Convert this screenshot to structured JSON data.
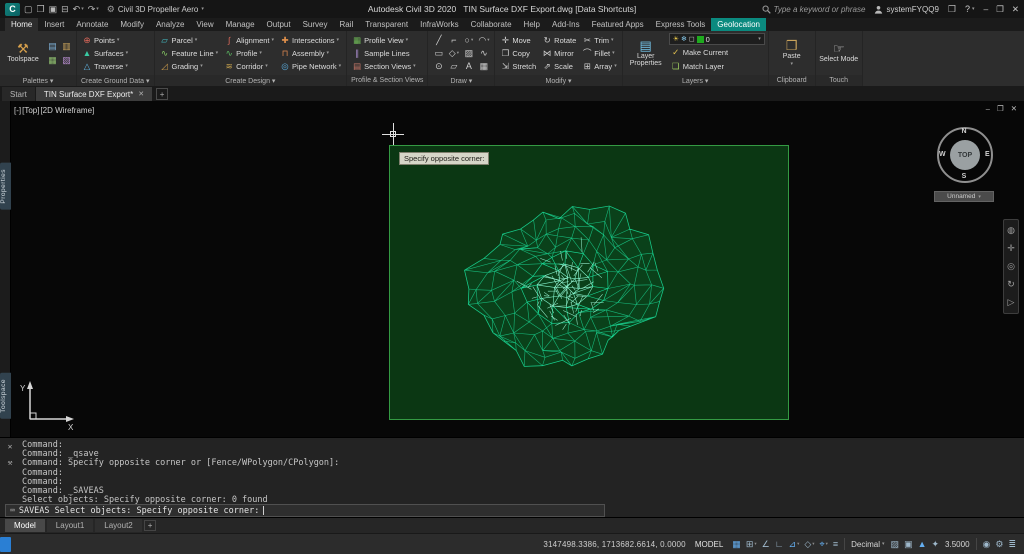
{
  "colors": {
    "accent_teal": "#0b8a7f",
    "mesh_green": "#2bffb4",
    "selection_fill": "#0c4f14",
    "status_blue": "#64aef0",
    "layer_swatch": "#1faa1f"
  },
  "title_bar": {
    "logo": "C",
    "quick_access": [
      {
        "name": "new-file-icon",
        "glyph": "▢"
      },
      {
        "name": "open-file-icon",
        "glyph": "❒"
      },
      {
        "name": "save-icon",
        "glyph": "▣"
      },
      {
        "name": "plot-icon",
        "glyph": "⊟"
      },
      {
        "name": "undo-icon",
        "glyph": "↶",
        "arrow": true
      },
      {
        "name": "redo-icon",
        "glyph": "↷",
        "arrow": true
      }
    ],
    "workspace": "Civil 3D Propeller Aero",
    "title": "Autodesk Civil 3D 2020",
    "document": "TIN Surface DXF Export.dwg",
    "document_badge": "[Data Shortcuts]",
    "search_placeholder": "Type a keyword or phrase",
    "user": "systemFYQQ9",
    "help_label": "?"
  },
  "ribbon": {
    "tabs": [
      {
        "label": "Home",
        "active": true
      },
      {
        "label": "Insert"
      },
      {
        "label": "Annotate"
      },
      {
        "label": "Modify"
      },
      {
        "label": "Analyze"
      },
      {
        "label": "View"
      },
      {
        "label": "Manage"
      },
      {
        "label": "Output"
      },
      {
        "label": "Survey"
      },
      {
        "label": "Rail"
      },
      {
        "label": "Transparent"
      },
      {
        "label": "InfraWorks"
      },
      {
        "label": "Collaborate"
      },
      {
        "label": "Help"
      },
      {
        "label": "Add-Ins"
      },
      {
        "label": "Featured Apps"
      },
      {
        "label": "Express Tools"
      },
      {
        "label": "Geolocation",
        "highlight": true
      }
    ],
    "panels": [
      {
        "label": "Palettes",
        "arrow": true,
        "type": "palettes",
        "big": {
          "label": "Toolspace",
          "icon": "toolbox-icon"
        },
        "small_icons": [
          "tool-palettes-icon",
          "properties-palette-icon",
          "survey-toolspace-icon",
          "panorama-icon"
        ]
      },
      {
        "label": "Create Ground Data",
        "arrow": true,
        "type": "stack",
        "buttons": [
          {
            "label": "Points",
            "icon": "points-icon",
            "arrow": true
          },
          {
            "label": "Surfaces",
            "icon": "surfaces-icon",
            "arrow": true
          },
          {
            "label": "Traverse",
            "icon": "traverse-icon",
            "arrow": true
          }
        ]
      },
      {
        "label": "Create Design",
        "arrow": true,
        "type": "grid3",
        "buttons": [
          {
            "label": "Parcel",
            "icon": "parcel-icon",
            "arrow": true
          },
          {
            "label": "Alignment",
            "icon": "alignment-icon",
            "arrow": true
          },
          {
            "label": "Intersections",
            "icon": "intersections-icon",
            "arrow": true
          },
          {
            "label": "Feature Line",
            "icon": "feature-line-icon",
            "arrow": true
          },
          {
            "label": "Profile",
            "icon": "profile-icon",
            "arrow": true
          },
          {
            "label": "Assembly",
            "icon": "assembly-icon",
            "arrow": true
          },
          {
            "label": "Grading",
            "icon": "grading-icon",
            "arrow": true
          },
          {
            "label": "Corridor",
            "icon": "corridor-icon",
            "arrow": true
          },
          {
            "label": "Pipe Network",
            "icon": "pipe-network-icon",
            "arrow": true
          }
        ]
      },
      {
        "label": "Profile & Section Views",
        "type": "stack",
        "buttons": [
          {
            "label": "Profile View",
            "icon": "profile-view-icon",
            "arrow": true
          },
          {
            "label": "Sample Lines",
            "icon": "sample-lines-icon"
          },
          {
            "label": "Section Views",
            "icon": "section-views-icon",
            "arrow": true
          }
        ]
      },
      {
        "label": "Draw",
        "arrow": true,
        "type": "icons",
        "icons": [
          {
            "name": "line-icon",
            "glyph": "╱"
          },
          {
            "name": "polyline-icon",
            "glyph": "⌐"
          },
          {
            "name": "circle-icon",
            "glyph": "○",
            "arrow": true
          },
          {
            "name": "arc-icon",
            "glyph": "◠",
            "arrow": true
          },
          {
            "name": "rectangle-icon",
            "glyph": "▭"
          },
          {
            "name": "ellipse-icon",
            "glyph": "◇",
            "arrow": true
          },
          {
            "name": "hatch-icon",
            "glyph": "▨"
          },
          {
            "name": "spline-icon",
            "glyph": "∿"
          },
          {
            "name": "point-icon",
            "glyph": "⊙"
          },
          {
            "name": "region-icon",
            "glyph": "▱"
          },
          {
            "name": "multiline-text-icon",
            "glyph": "A"
          },
          {
            "name": "table-icon",
            "glyph": "▦"
          }
        ]
      },
      {
        "label": "Modify",
        "arrow": true,
        "type": "grid3",
        "buttons": [
          {
            "label": "Move",
            "icon": "move-icon"
          },
          {
            "label": "Rotate",
            "icon": "rotate-icon"
          },
          {
            "label": "Trim",
            "icon": "trim-icon",
            "arrow": true
          },
          {
            "label": "Copy",
            "icon": "copy-icon"
          },
          {
            "label": "Mirror",
            "icon": "mirror-icon"
          },
          {
            "label": "Fillet",
            "icon": "fillet-icon",
            "arrow": true
          },
          {
            "label": "Stretch",
            "icon": "stretch-icon"
          },
          {
            "label": "Scale",
            "icon": "scale-icon"
          },
          {
            "label": "Array",
            "icon": "array-icon",
            "arrow": true
          }
        ]
      },
      {
        "label": "Layers",
        "arrow": true,
        "type": "layers",
        "big": {
          "label": "Layer Properties",
          "icon": "layer-properties-icon"
        },
        "combo": {
          "value": "0",
          "icons": [
            "layer-on-icon",
            "layer-freeze-icon",
            "layer-lock-icon"
          ]
        },
        "buttons": [
          {
            "label": "Make Current",
            "icon": "make-current-icon"
          },
          {
            "label": "Match Layer",
            "icon": "match-layer-icon"
          }
        ]
      },
      {
        "label": "Clipboard",
        "type": "big",
        "big": {
          "label": "Paste",
          "icon": "paste-icon",
          "arrow": true
        }
      },
      {
        "label": "Touch",
        "type": "big",
        "big": {
          "label": "Select Mode",
          "icon": "select-mode-icon"
        }
      }
    ]
  },
  "file_tabs": {
    "tabs": [
      {
        "label": "Start"
      },
      {
        "label": "TIN Surface DXF Export*",
        "active": true,
        "closable": true
      }
    ],
    "add_label": "+"
  },
  "canvas": {
    "viewport_controls": [
      "[-]",
      "[Top]",
      "[2D Wireframe]"
    ],
    "tooltip": "Specify opposite corner:",
    "viewcube": {
      "n": "N",
      "e": "E",
      "s": "S",
      "w": "W",
      "face": "TOP",
      "label": "Unnamed"
    },
    "nav_icons": [
      {
        "name": "navigation-wheel-icon",
        "glyph": "◍"
      },
      {
        "name": "pan-icon",
        "glyph": "✛"
      },
      {
        "name": "zoom-icon",
        "glyph": "◎"
      },
      {
        "name": "orbit-icon",
        "glyph": "↻"
      },
      {
        "name": "showmotion-icon",
        "glyph": "▷"
      }
    ],
    "side_tabs": [
      "Properties",
      "Toolspace"
    ],
    "ucs": {
      "x": "X",
      "y": "Y"
    }
  },
  "command": {
    "rail": [
      {
        "name": "close-command-window-icon",
        "glyph": "✕"
      },
      {
        "name": "customize-command-icon",
        "glyph": "⚒"
      }
    ],
    "history": [
      "Command:",
      "Command: _qsave",
      "Command: Specify opposite corner or [Fence/WPolygon/CPolygon]:",
      "Command:",
      "Command:",
      "Command: _SAVEAS",
      "Select objects: Specify opposite corner: 0 found"
    ],
    "prompt_icon": {
      "name": "command-input-icon",
      "glyph": "⌨"
    },
    "prompt": "SAVEAS Select objects: Specify opposite corner:"
  },
  "layout_tabs": {
    "tabs": [
      {
        "label": "Model",
        "active": true
      },
      {
        "label": "Layout1"
      },
      {
        "label": "Layout2"
      }
    ],
    "add_label": "+"
  },
  "status_bar": {
    "coordinates": "3147498.3386, 1713682.6614, 0.0000",
    "space_label": "MODEL",
    "toggles": [
      {
        "name": "grid-display-icon",
        "glyph": "▦",
        "on": true
      },
      {
        "name": "snap-mode-icon",
        "glyph": "⊞",
        "arrow": true
      },
      {
        "name": "infer-constraints-icon",
        "glyph": "∠"
      },
      {
        "name": "ortho-mode-icon",
        "glyph": "∟"
      },
      {
        "name": "polar-tracking-icon",
        "glyph": "⊿",
        "arrow": true,
        "on": true
      },
      {
        "name": "isometric-drafting-icon",
        "glyph": "◇",
        "arrow": true
      },
      {
        "name": "object-snap-icon",
        "glyph": "⌖",
        "arrow": true,
        "on": true
      },
      {
        "name": "lineweight-icon",
        "glyph": "≡"
      }
    ],
    "units_label": "Decimal",
    "right_toggles": [
      {
        "name": "transparency-icon",
        "glyph": "▨"
      },
      {
        "name": "selection-cycling-icon",
        "glyph": "▣"
      },
      {
        "name": "annotation-visibility-icon",
        "glyph": "▲",
        "on": true
      },
      {
        "name": "autoscale-icon",
        "glyph": "✦"
      }
    ],
    "scale_value": "3.5000",
    "far_right": [
      {
        "name": "isolate-objects-icon",
        "glyph": "◉"
      },
      {
        "name": "gear-icon",
        "glyph": "⚙"
      },
      {
        "name": "customize-icon",
        "glyph": "≣"
      }
    ]
  }
}
